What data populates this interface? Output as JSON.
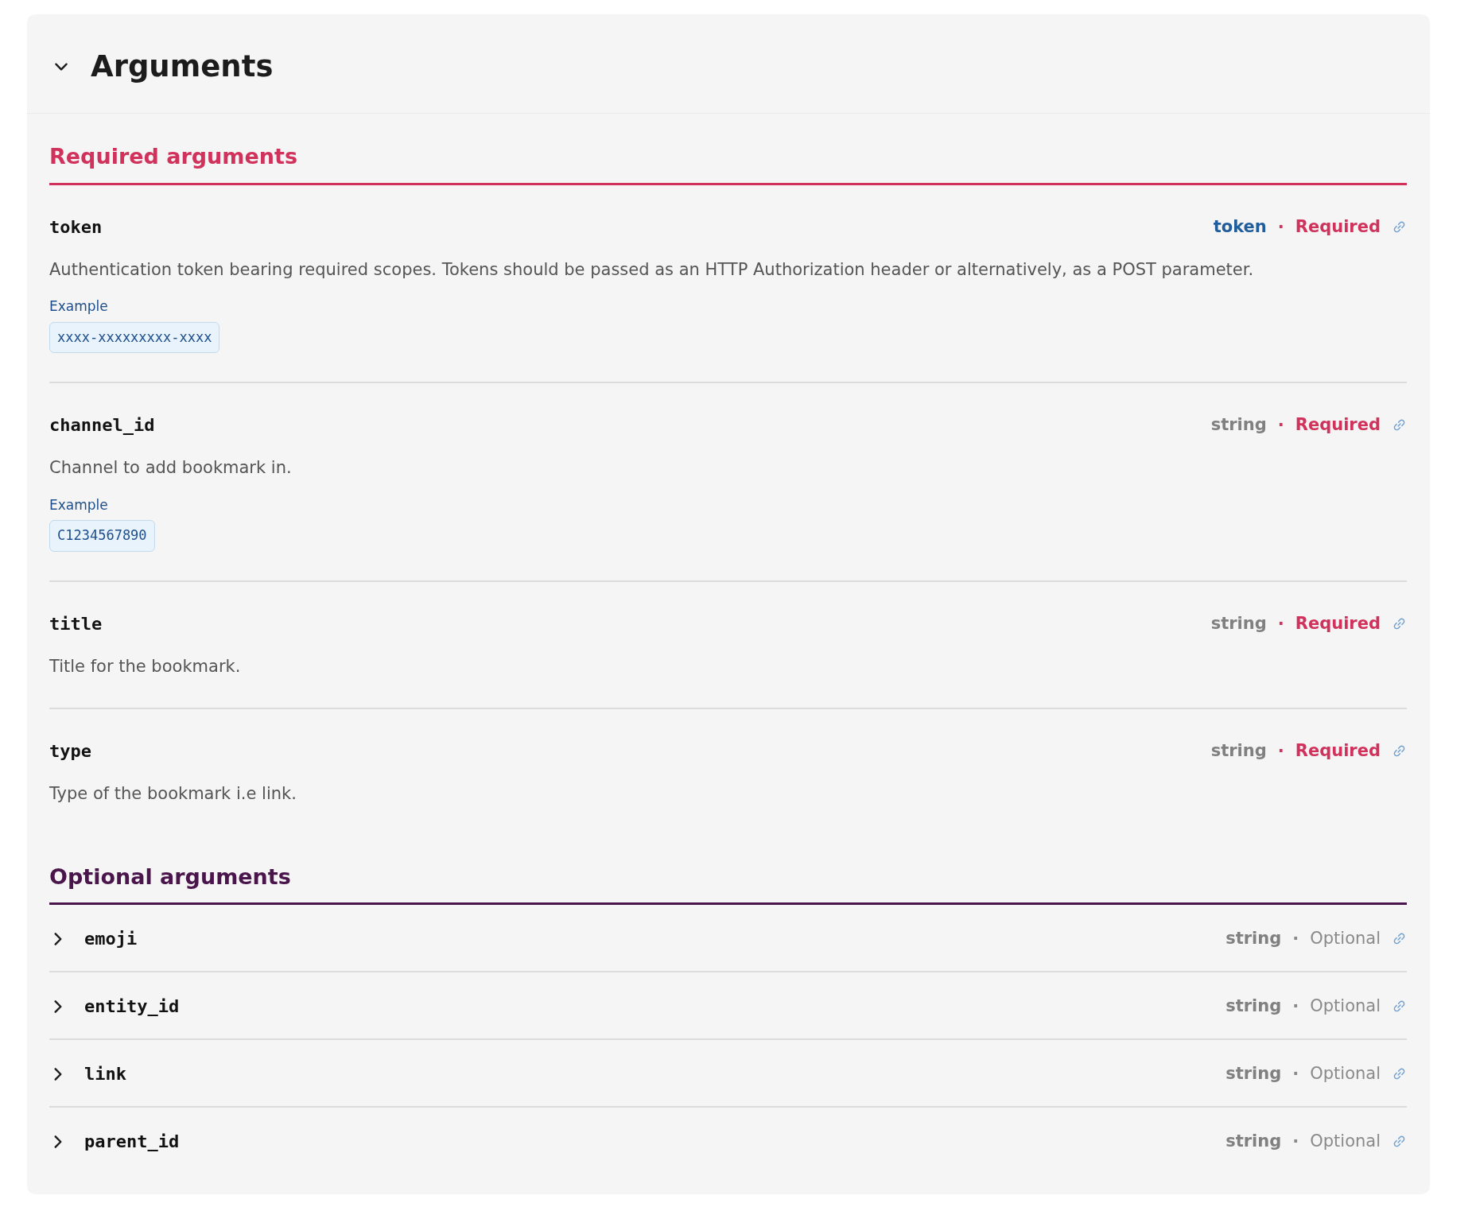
{
  "panel": {
    "title": "Arguments",
    "expanded": true
  },
  "sections": [
    {
      "kind": "required",
      "heading": "Required arguments",
      "items": [
        {
          "name": "token",
          "type": "token",
          "type_linked": true,
          "separator": "·",
          "requirement": "Required",
          "description": "Authentication token bearing required scopes. Tokens should be passed as an HTTP Authorization header or alternatively, as a POST parameter.",
          "example_label": "Example",
          "example": "xxxx-xxxxxxxxx-xxxx"
        },
        {
          "name": "channel_id",
          "type": "string",
          "type_linked": false,
          "separator": "·",
          "requirement": "Required",
          "description": "Channel to add bookmark in.",
          "example_label": "Example",
          "example": "C1234567890"
        },
        {
          "name": "title",
          "type": "string",
          "type_linked": false,
          "separator": "·",
          "requirement": "Required",
          "description": "Title for the bookmark."
        },
        {
          "name": "type",
          "type": "string",
          "type_linked": false,
          "separator": "·",
          "requirement": "Required",
          "description": "Type of the bookmark i.e link."
        }
      ]
    },
    {
      "kind": "optional",
      "heading": "Optional arguments",
      "items": [
        {
          "name": "emoji",
          "type": "string",
          "type_linked": false,
          "separator": "·",
          "requirement": "Optional",
          "expanded": false
        },
        {
          "name": "entity_id",
          "type": "string",
          "type_linked": false,
          "separator": "·",
          "requirement": "Optional",
          "expanded": false
        },
        {
          "name": "link",
          "type": "string",
          "type_linked": false,
          "separator": "·",
          "requirement": "Optional",
          "expanded": false
        },
        {
          "name": "parent_id",
          "type": "string",
          "type_linked": false,
          "separator": "·",
          "requirement": "Optional",
          "expanded": false
        }
      ]
    }
  ]
}
